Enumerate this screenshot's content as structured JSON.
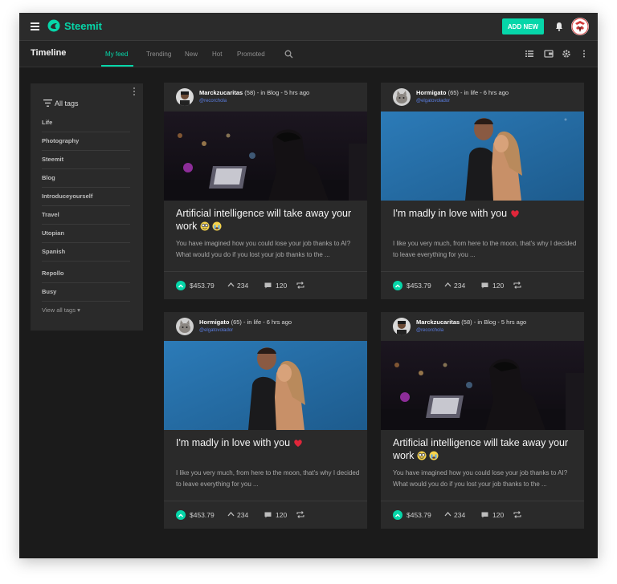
{
  "app": {
    "brand": "Steemit",
    "add_new_label": "ADD NEW",
    "accent_color": "#06d6a9"
  },
  "navbar": {
    "title": "Timeline",
    "tabs": [
      {
        "label": "My feed",
        "active": true
      },
      {
        "label": "Trending",
        "active": false
      },
      {
        "label": "New",
        "active": false
      },
      {
        "label": "Hot",
        "active": false
      },
      {
        "label": "Promoted",
        "active": false
      }
    ],
    "icons": [
      "search-icon",
      "list-view-icon",
      "wallet-icon",
      "settings-icon",
      "more-vert-icon"
    ]
  },
  "sidebar": {
    "heading": "All tags",
    "items": [
      "Life",
      "Photography",
      "Steemit",
      "Blog",
      "Introduceyourself",
      "Travel",
      "Utopian",
      "Spanish",
      "Repollo",
      "Busy"
    ],
    "view_all": "View all tags"
  },
  "cards": [
    {
      "author": "Marckzucaritas",
      "reputation": "(58)",
      "meta": "- in Blog - 5 hrs ago",
      "handle": "@recorchola",
      "image": "man-laptop-night-photo",
      "title": "Artificial intelligence will take away your work",
      "title_emojis": [
        "nerd-face-emoji",
        "crying-face-emoji"
      ],
      "excerpt": "You have imagined how you could lose your job thanks to AI? What would you do if you lost your job thanks to the ...",
      "payout": "$453.79",
      "votes": "234",
      "comments": "120"
    },
    {
      "author": "Hormigato",
      "reputation": "(65)",
      "meta": "- in life - 6 hrs ago",
      "handle": "@elgatovolador",
      "image": "couple-hugging-photo",
      "title": "I'm madly in love with you",
      "title_emojis": [
        "heart-emoji"
      ],
      "excerpt": "I like you very much, from here to the moon, that's why I decided to leave everything for you ...",
      "payout": "$453.79",
      "votes": "234",
      "comments": "120"
    },
    {
      "author": "Hormigato",
      "reputation": "(65)",
      "meta": "- in life - 6 hrs ago",
      "handle": "@elgatovolador",
      "image": "couple-hugging-photo",
      "title": "I'm madly in love with you",
      "title_emojis": [
        "heart-emoji"
      ],
      "excerpt": "I like you very much, from here to the moon, that's why I decided to leave everything for you ...",
      "payout": "$453.79",
      "votes": "234",
      "comments": "120"
    },
    {
      "author": "Marckzucaritas",
      "reputation": "(58)",
      "meta": "- in Blog - 5 hrs ago",
      "handle": "@recorchola",
      "image": "man-laptop-night-photo",
      "title": "Artificial intelligence will take away your work",
      "title_emojis": [
        "nerd-face-emoji",
        "crying-face-emoji"
      ],
      "excerpt": "You have imagined how you could lose your job thanks to AI? What would you do if you lost your job thanks to the ...",
      "payout": "$453.79",
      "votes": "234",
      "comments": "120"
    }
  ]
}
